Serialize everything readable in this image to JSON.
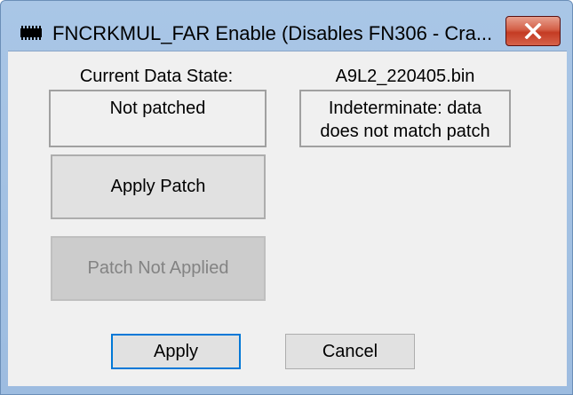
{
  "window": {
    "title": "FNCRKMUL_FAR Enable (Disables FN306 - Cra..."
  },
  "labels": {
    "current_data_state": "Current Data State:",
    "file_name": "A9L2_220405.bin"
  },
  "state": {
    "current": "Not patched",
    "file_line1": "Indeterminate: data",
    "file_line2": "does not match patch"
  },
  "buttons": {
    "apply_patch": "Apply Patch",
    "patch_not_applied": "Patch Not Applied",
    "apply": "Apply",
    "cancel": "Cancel"
  },
  "icons": {
    "window_icon": "chip-icon",
    "close": "close-icon"
  },
  "colors": {
    "close_button": "#c43b23",
    "default_button_border": "#0078d7",
    "dialog_background": "#f0f0f0"
  }
}
